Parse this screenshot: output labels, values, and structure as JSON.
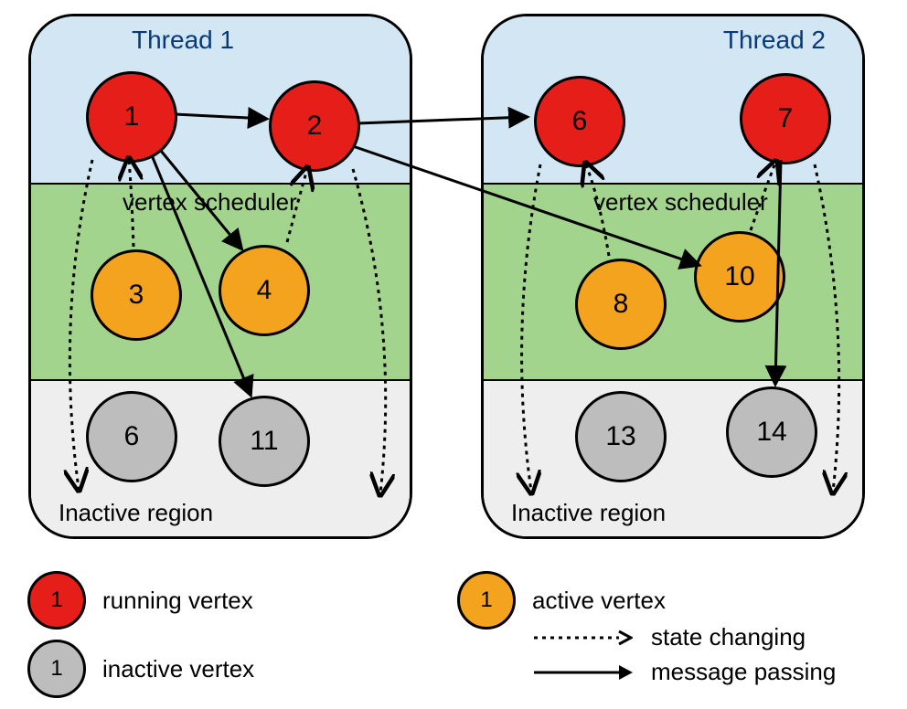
{
  "threads": {
    "t1": {
      "title": "Thread 1",
      "scheduler_label": "vertex scheduler",
      "inactive_label": "Inactive region",
      "vertices": {
        "v1": "1",
        "v2": "2",
        "v3": "3",
        "v4": "4",
        "v6i": "6",
        "v11": "11"
      }
    },
    "t2": {
      "title": "Thread 2",
      "scheduler_label": "vertex scheduler",
      "inactive_label": "Inactive region",
      "vertices": {
        "v6": "6",
        "v7": "7",
        "v8": "8",
        "v10": "10",
        "v13": "13",
        "v14": "14"
      }
    }
  },
  "legend": {
    "running": {
      "number": "1",
      "label": "running vertex"
    },
    "inactive": {
      "number": "1",
      "label": "inactive vertex"
    },
    "active": {
      "number": "1",
      "label": "active vertex"
    },
    "state_changing": "state changing",
    "message_passing": "message passing"
  },
  "colors": {
    "running": "#E61E1A",
    "active": "#F3A31D",
    "inactive": "#BDBDBD",
    "region_running": "#D2E6F3",
    "region_scheduler": "#A3D48E",
    "region_inactive": "#EEEEEE"
  },
  "diagram": {
    "type": "graph-process-diagram",
    "regions": [
      "running",
      "vertex scheduler",
      "inactive region"
    ],
    "vertex_states": {
      "1": {
        "thread": 1,
        "state": "running"
      },
      "2": {
        "thread": 1,
        "state": "running"
      },
      "3": {
        "thread": 1,
        "state": "active"
      },
      "4": {
        "thread": 1,
        "state": "active"
      },
      "6_t1_inactive": {
        "thread": 1,
        "state": "inactive",
        "label": "6"
      },
      "11": {
        "thread": 1,
        "state": "inactive"
      },
      "6": {
        "thread": 2,
        "state": "running"
      },
      "7": {
        "thread": 2,
        "state": "running"
      },
      "8": {
        "thread": 2,
        "state": "active"
      },
      "10": {
        "thread": 2,
        "state": "active"
      },
      "13": {
        "thread": 2,
        "state": "inactive"
      },
      "14": {
        "thread": 2,
        "state": "inactive"
      }
    },
    "edges_message_passing": [
      {
        "from": "1",
        "to": "2"
      },
      {
        "from": "1",
        "to": "4"
      },
      {
        "from": "1",
        "to": "11"
      },
      {
        "from": "2",
        "to": "6"
      },
      {
        "from": "2",
        "to": "10"
      },
      {
        "from": "7",
        "to": "14"
      }
    ],
    "edges_state_changing": [
      {
        "from": "3",
        "to": "1",
        "direction": "scheduler->running"
      },
      {
        "from": "4",
        "to": "2",
        "direction": "scheduler->running"
      },
      {
        "from": "1",
        "to": "6_t1_inactive",
        "direction": "running->inactive"
      },
      {
        "from": "2",
        "to": "11",
        "direction": "running->inactive",
        "note": "curved down right"
      },
      {
        "from": "8",
        "to": "6",
        "direction": "scheduler->running"
      },
      {
        "from": "10",
        "to": "7",
        "direction": "scheduler->running"
      },
      {
        "from": "6",
        "to": "13",
        "direction": "running->inactive"
      },
      {
        "from": "7",
        "to": "14",
        "direction": "running->inactive"
      }
    ]
  }
}
